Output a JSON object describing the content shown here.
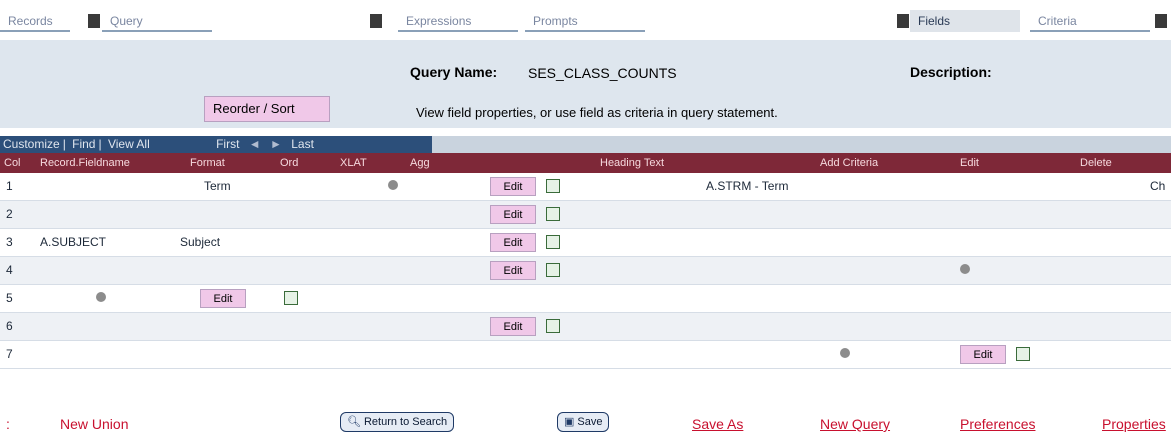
{
  "tabs": [
    {
      "label": "Records"
    },
    {
      "label": "Query"
    },
    {
      "label": "Expressions"
    },
    {
      "label": "Prompts"
    },
    {
      "label": "Fields"
    },
    {
      "label": "Criteria"
    }
  ],
  "header": {
    "query_name_label": "Query Name:",
    "query_name_value": "SES_CLASS_COUNTS",
    "description_label": "Description:",
    "reorder_button": "Reorder / Sort",
    "instruction": "View field properties, or use field as criteria in query statement."
  },
  "grid_nav": {
    "customize": "Customize",
    "find": "Find",
    "view_all": "View All",
    "first": "First",
    "last": "Last"
  },
  "columns": [
    "Col",
    "Record.Fieldname",
    "Format",
    "Ord",
    "XLAT",
    "Agg",
    "Heading Text",
    "Add Criteria",
    "Edit",
    "Delete"
  ],
  "rows": [
    {
      "col": "1",
      "field": "Term",
      "heading": "A.STRM - Term",
      "text": "Ch",
      "edit": "Edit"
    },
    {
      "col": "2",
      "field": "",
      "heading": "",
      "text": "",
      "edit": "Edit"
    },
    {
      "col": "3",
      "field": "A.SUBJECT",
      "heading": "Subject",
      "text": "",
      "edit": "Edit"
    },
    {
      "col": "4",
      "field": "",
      "heading": "",
      "text": "",
      "edit": "Edit"
    },
    {
      "col": "5",
      "field": "",
      "heading": "",
      "text": "",
      "edit": "Edit"
    },
    {
      "col": "6",
      "field": "",
      "heading": "",
      "text": "",
      "edit": "Edit"
    },
    {
      "col": "7",
      "field": "",
      "heading": "",
      "text": "",
      "edit": "Edit"
    }
  ],
  "footer": {
    "new_union": "New Union",
    "return_to_search": "Return to Search",
    "save": "Save",
    "save_as": "Save As",
    "new_query": "New Query",
    "preferences": "Preferences",
    "properties": "Properties"
  },
  "colors": {
    "header_bg": "#dee6ee",
    "grid_header_bg": "#7e2838",
    "nav_bar_bg": "#2c4f7a",
    "link_color": "#c8102e",
    "button_pink": "#f0c8e8"
  }
}
